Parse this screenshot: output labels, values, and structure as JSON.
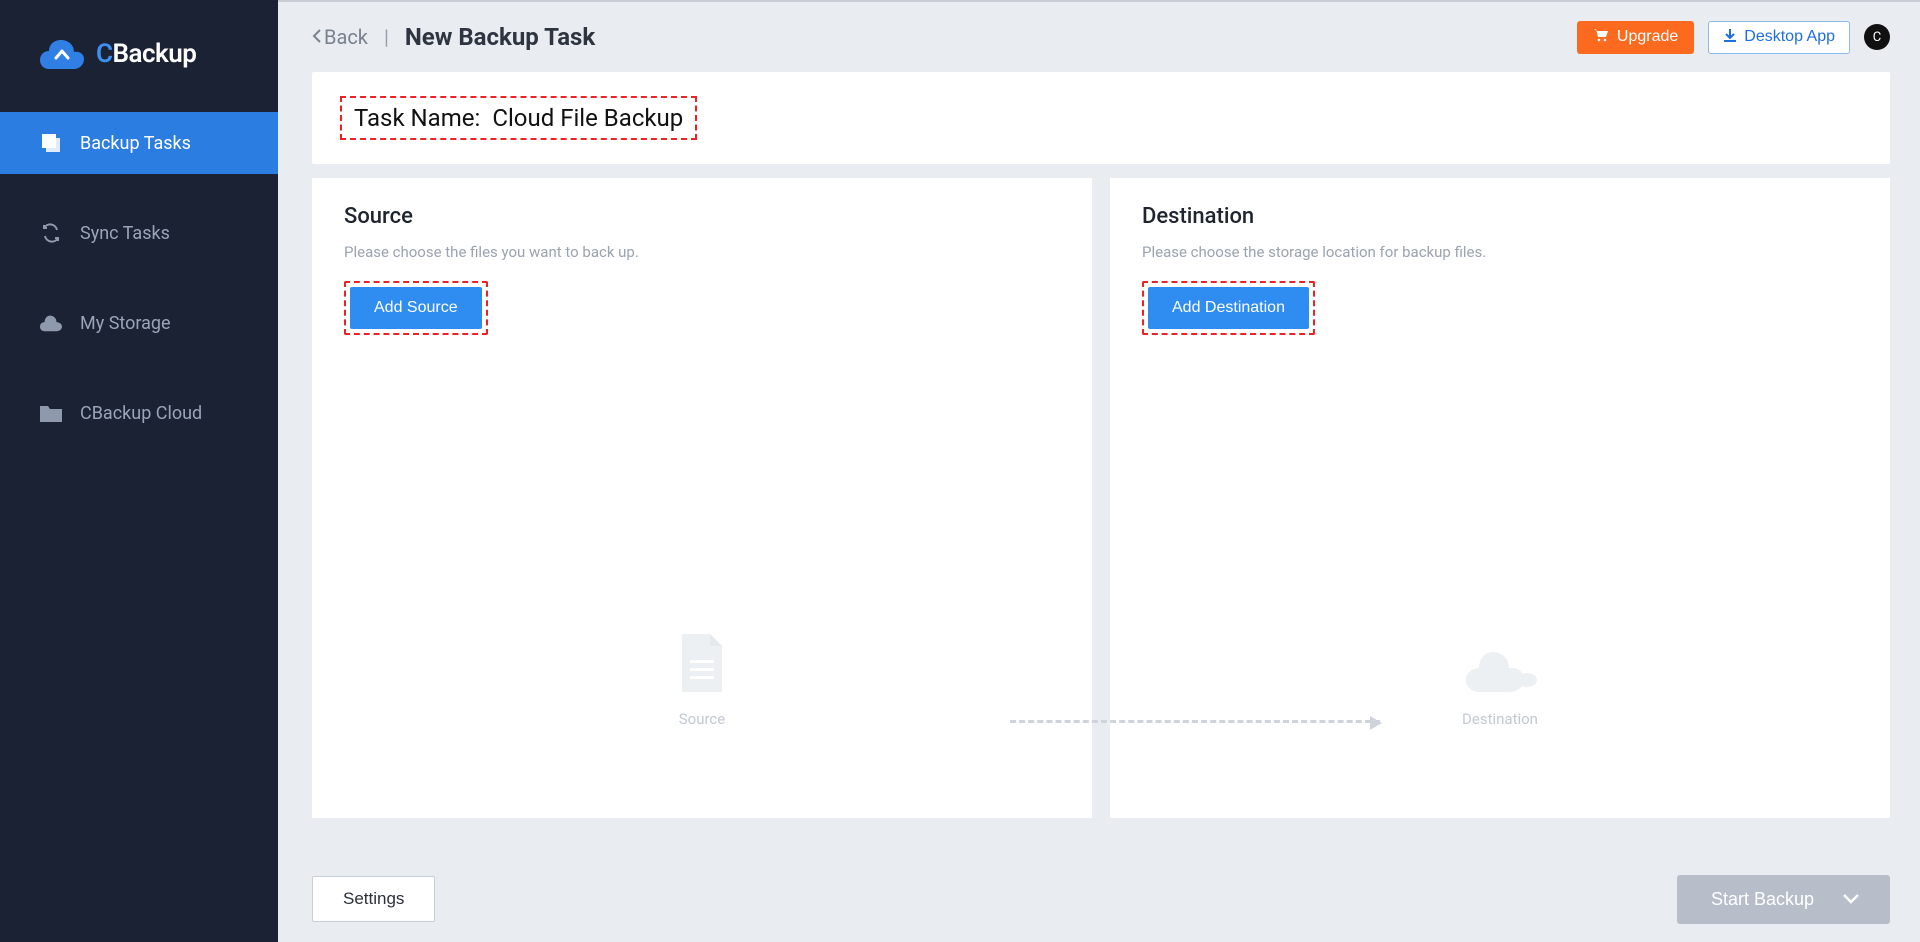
{
  "brand": {
    "name": "CBackup"
  },
  "sidebar": {
    "items": [
      {
        "label": "Backup Tasks",
        "active": true
      },
      {
        "label": "Sync Tasks",
        "active": false
      },
      {
        "label": "My Storage",
        "active": false
      },
      {
        "label": "CBackup Cloud",
        "active": false
      }
    ]
  },
  "topbar": {
    "back": "Back",
    "title": "New Backup Task",
    "upgrade": "Upgrade",
    "desktop": "Desktop App",
    "avatar_initial": "C"
  },
  "task": {
    "name_label": "Task Name:",
    "name_value": "Cloud File Backup"
  },
  "source": {
    "title": "Source",
    "subtitle": "Please choose the files you want to back up.",
    "button": "Add Source",
    "placeholder": "Source"
  },
  "destination": {
    "title": "Destination",
    "subtitle": "Please choose the storage location for backup files.",
    "button": "Add Destination",
    "placeholder": "Destination"
  },
  "footer": {
    "settings": "Settings",
    "start": "Start Backup"
  }
}
